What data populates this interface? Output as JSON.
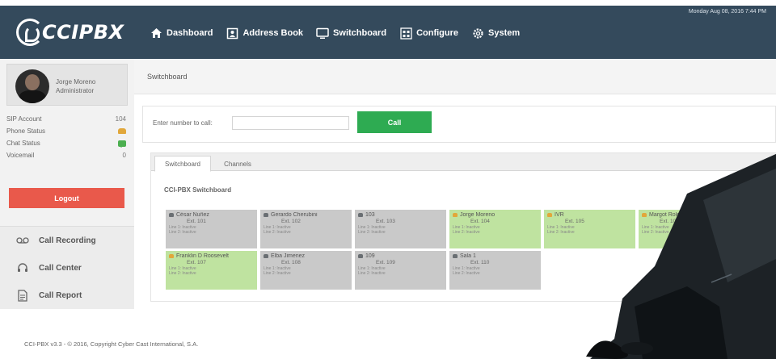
{
  "header": {
    "logo_text": "CCIPBX",
    "datetime": "Monday Aug 08, 2016 7:44 PM",
    "nav": [
      {
        "label": "Dashboard",
        "icon": "home-icon"
      },
      {
        "label": "Address Book",
        "icon": "address-book-icon"
      },
      {
        "label": "Switchboard",
        "icon": "monitor-icon"
      },
      {
        "label": "Configure",
        "icon": "configure-icon"
      },
      {
        "label": "System",
        "icon": "gear-icon"
      }
    ]
  },
  "sidebar": {
    "user_name": "Jorge Moreno",
    "user_role": "Administrator",
    "stats": [
      {
        "label": "SIP Account",
        "value": "104"
      },
      {
        "label": "Phone Status",
        "value": "",
        "icon": "phone-status-icon"
      },
      {
        "label": "Chat Status",
        "value": "",
        "icon": "chat-status-icon"
      },
      {
        "label": "Voicemail",
        "value": "0"
      }
    ],
    "logout_label": "Logout",
    "menu": [
      {
        "label": "Call Recording",
        "icon": "recording-icon"
      },
      {
        "label": "Call Center",
        "icon": "headset-icon"
      },
      {
        "label": "Call Report",
        "icon": "report-icon"
      }
    ]
  },
  "main": {
    "breadcrumb": "Switchboard",
    "call_label": "Enter number to call:",
    "call_input_value": "",
    "call_button": "Call",
    "tabs": [
      {
        "label": "Switchboard",
        "active": true
      },
      {
        "label": "Channels",
        "active": false
      }
    ],
    "panel_title": "CCI-PBX Switchboard",
    "extensions": [
      {
        "name": "César Nuñez",
        "ext": "Ext. 101",
        "line1": "Line 1: Inactive",
        "line2": "Line 2: Inactive",
        "status": "gray"
      },
      {
        "name": "Gerardo Cherubini",
        "ext": "Ext. 102",
        "line1": "Line 1: Inactive",
        "line2": "Line 2: Inactive",
        "status": "gray"
      },
      {
        "name": "103",
        "ext": "Ext. 103",
        "line1": "Line 1: Inactive",
        "line2": "Line 2: Inactive",
        "status": "gray"
      },
      {
        "name": "Jorge Moreno",
        "ext": "Ext. 104",
        "line1": "Line 1: Inactive",
        "line2": "Line 2: Inactive",
        "status": "green"
      },
      {
        "name": "IVR",
        "ext": "Ext. 105",
        "line1": "Line 1: Inactive",
        "line2": "Line 2: Inactive",
        "status": "green"
      },
      {
        "name": "Margot Roldán",
        "ext": "Ext. 106",
        "line1": "Line 1: Inactive",
        "line2": "Line 2: Inactive",
        "status": "green"
      },
      {
        "name": "Franklin D Roosevelt",
        "ext": "Ext. 107",
        "line1": "Line 1: Inactive",
        "line2": "Line 2: Inactive",
        "status": "green"
      },
      {
        "name": "Elba Jimenez",
        "ext": "Ext. 108",
        "line1": "Line 1: Inactive",
        "line2": "Line 2: Inactive",
        "status": "gray"
      },
      {
        "name": "109",
        "ext": "Ext. 109",
        "line1": "Line 1: Inactive",
        "line2": "Line 2: Inactive",
        "status": "gray"
      },
      {
        "name": "Sala 1",
        "ext": "Ext. 110",
        "line1": "Line 1: Inactive",
        "line2": "Line 2: Inactive",
        "status": "gray"
      }
    ]
  },
  "footer": "CCI-PBX v3.3 - © 2016, Copyright Cyber Cast International, S.A."
}
